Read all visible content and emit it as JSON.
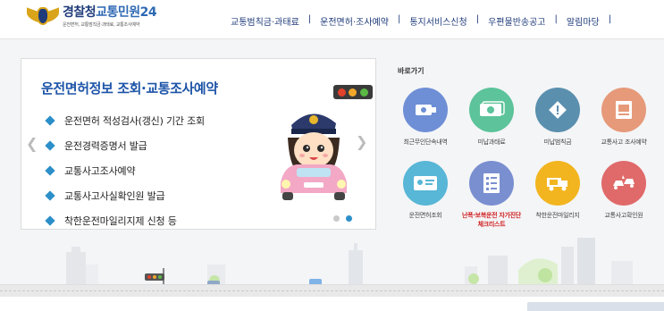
{
  "header": {
    "logo_title_1": "경찰청",
    "logo_title_2": "교통민원24",
    "logo_subtitle": "운전면허, 교통범칙금·과태료, 교통조사예약",
    "nav": [
      "교통범칙금·과태료",
      "운전면허·조사예약",
      "통지서비스신청",
      "우편물반송공고",
      "알림마당"
    ]
  },
  "slide": {
    "title": "운전면허정보 조회·교통조사예약",
    "items": [
      "운전면허 적성검사(갱신) 기간 조회",
      "운전경력증명서 발급",
      "교통사고조사예약",
      "교통사고사실확인원 발급",
      "착한운전마일리지제 신청 등"
    ],
    "prev_arrow": "❮",
    "next_arrow": "❯"
  },
  "quick": {
    "title": "바로가기",
    "items": [
      {
        "label": "최근무인단속내역",
        "icon": "camera-icon",
        "color": "#6e8fd6"
      },
      {
        "label": "미납과태료",
        "icon": "money-icon",
        "color": "#5cc39a"
      },
      {
        "label": "미납범칙금",
        "icon": "warning-icon",
        "color": "#5a8fae"
      },
      {
        "label": "교통사고 조사예약",
        "icon": "accident-report-icon",
        "color": "#e69a7a"
      },
      {
        "label": "운전면허조회",
        "icon": "license-card-icon",
        "color": "#58b6d6"
      },
      {
        "label": "난폭·보복운전 자가진단 체크리스트",
        "icon": "checklist-icon",
        "color": "#7a8fd0"
      },
      {
        "label": "착한운전마일리지",
        "icon": "mileage-truck-icon",
        "color": "#f2b51f"
      },
      {
        "label": "교통사고확인원",
        "icon": "car-crash-icon",
        "color": "#e06a6a"
      }
    ]
  },
  "colors": {
    "brand": "#1f3b7a",
    "accent": "#1e55a8",
    "bullet": "#2c8fc9"
  }
}
